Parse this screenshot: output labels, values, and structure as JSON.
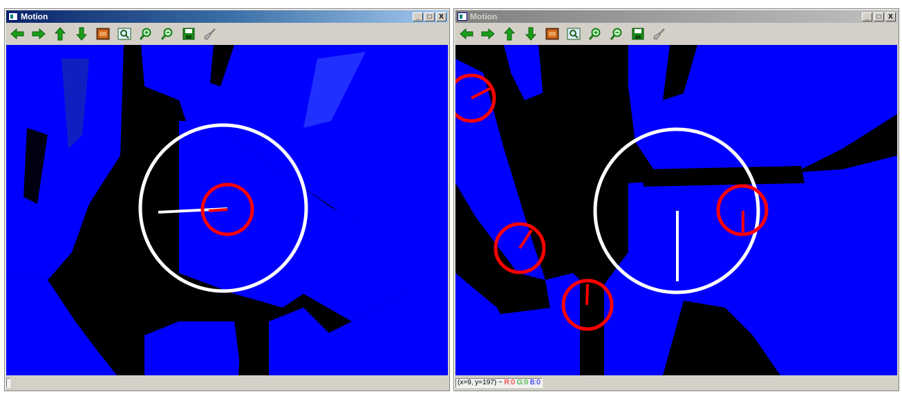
{
  "colors": {
    "canvas_blue": "#0000ff",
    "canvas_black": "#000000",
    "arrow_green": "#1a9d1a",
    "marker_white": "#ffffff",
    "marker_red": "#ff0000"
  },
  "windows": {
    "left": {
      "title": "Motion",
      "controls": {
        "minimize": "_",
        "maximize": "□",
        "close": "X"
      },
      "toolbar_icons": [
        "left-arrow-icon",
        "right-arrow-icon",
        "up-arrow-icon",
        "down-arrow-icon",
        "image-icon",
        "zoom-fit-icon",
        "zoom-in-icon",
        "zoom-out-icon",
        "save-icon",
        "brush-icon"
      ],
      "status": ""
    },
    "right": {
      "title": "Motion",
      "controls": {
        "minimize": "_",
        "maximize": "□",
        "close": "X"
      },
      "toolbar_icons": [
        "left-arrow-icon",
        "right-arrow-icon",
        "up-arrow-icon",
        "down-arrow-icon",
        "image-icon",
        "zoom-fit-icon",
        "zoom-in-icon",
        "zoom-out-icon",
        "save-icon",
        "brush-icon"
      ],
      "status": {
        "coords": "(x=9, y=197) ~",
        "r": "R:0",
        "g": "G:0",
        "b": "B:0"
      }
    }
  }
}
